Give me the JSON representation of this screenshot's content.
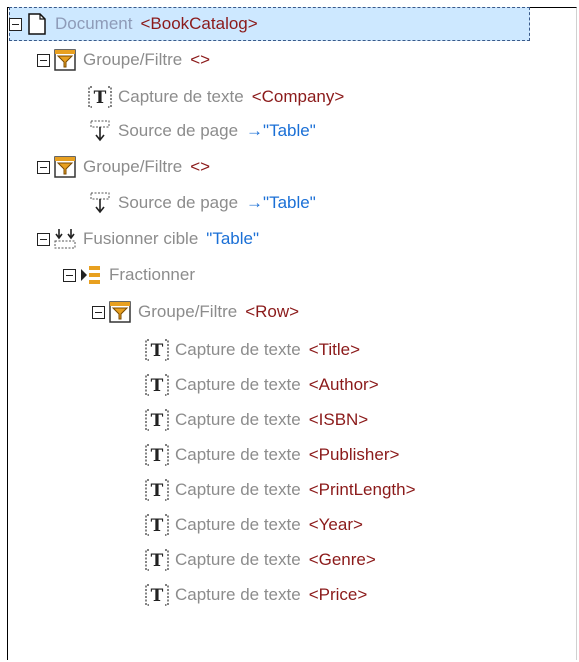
{
  "tree": {
    "root": {
      "kind": "Document",
      "value": "<BookCatalog>"
    },
    "group1": {
      "kind": "Groupe/Filtre",
      "value": "<>"
    },
    "capture_company": {
      "kind": "Capture de texte",
      "value": "<Company>"
    },
    "source1": {
      "kind": "Source de page",
      "value": "→\"Table\""
    },
    "group2": {
      "kind": "Groupe/Filtre",
      "value": "<>"
    },
    "source2": {
      "kind": "Source de page",
      "value": "→\"Table\""
    },
    "merge": {
      "kind": "Fusionner cible",
      "value": "\"Table\""
    },
    "split": {
      "kind": "Fractionner"
    },
    "group3": {
      "kind": "Groupe/Filtre",
      "value": "<Row>"
    },
    "captures": [
      {
        "kind": "Capture de texte",
        "value": "<Title>"
      },
      {
        "kind": "Capture de texte",
        "value": "<Author>"
      },
      {
        "kind": "Capture de texte",
        "value": "<ISBN>"
      },
      {
        "kind": "Capture de texte",
        "value": "<Publisher>"
      },
      {
        "kind": "Capture de texte",
        "value": "<PrintLength>"
      },
      {
        "kind": "Capture de texte",
        "value": "<Year>"
      },
      {
        "kind": "Capture de texte",
        "value": "<Genre>"
      },
      {
        "kind": "Capture de texte",
        "value": "<Price>"
      }
    ]
  },
  "colors": {
    "selection": "#cde8ff",
    "value_red": "#8b1a1a",
    "value_blue": "#1a6fd6",
    "kind_gray": "#8c8c8c",
    "filter_orange": "#e8a020"
  }
}
